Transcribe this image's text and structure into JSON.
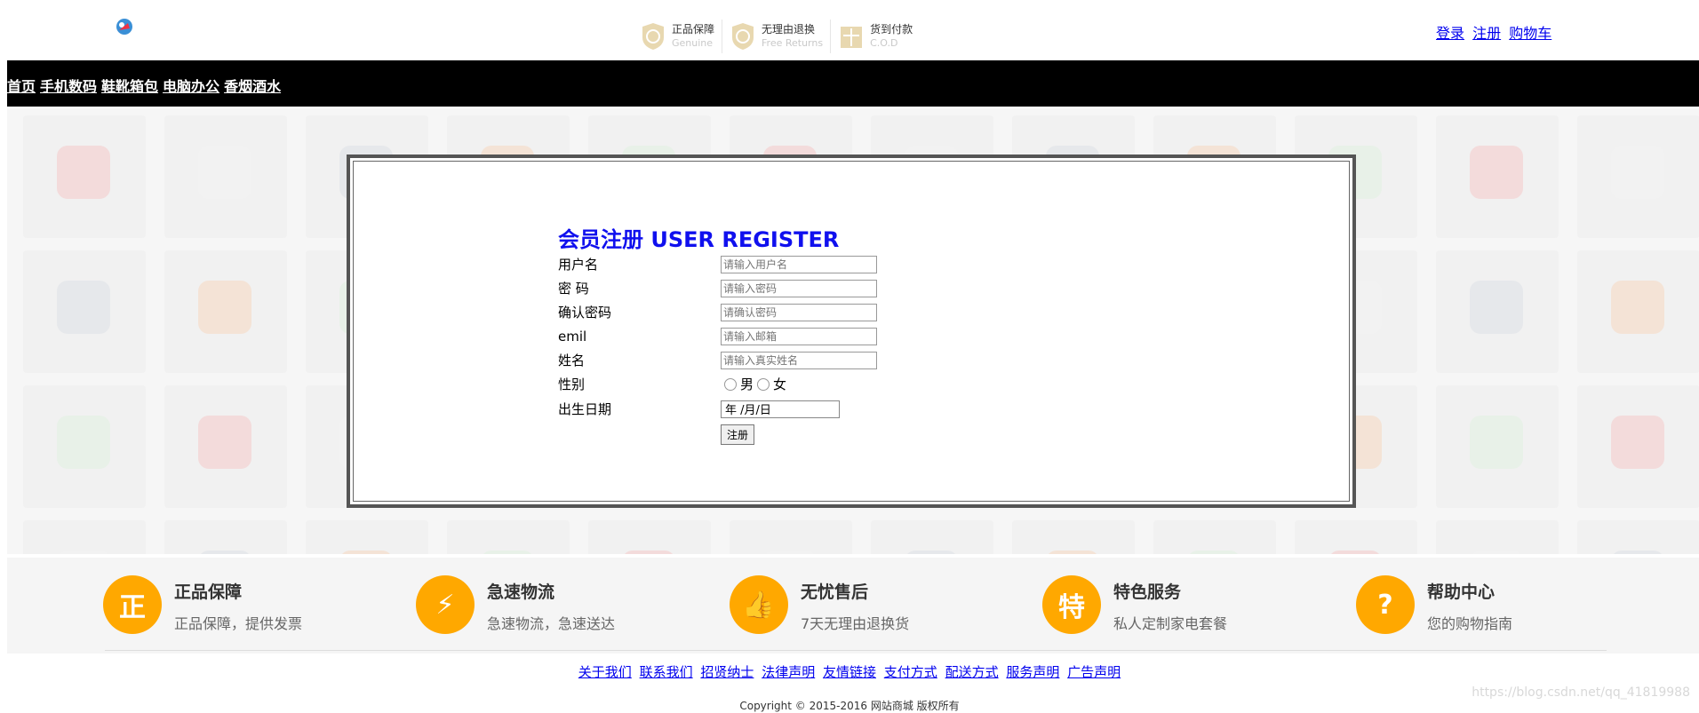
{
  "header": {
    "guarantees": [
      {
        "cn": "正品保障",
        "en": "Genuine",
        "icon": "genuine-shield-icon"
      },
      {
        "cn": "无理由退换",
        "en": "Free Returns",
        "icon": "returns-shield-icon"
      },
      {
        "cn": "货到付款",
        "en": "C.O.D",
        "icon": "cod-icon"
      }
    ],
    "links": {
      "login": "登录",
      "register": "注册",
      "cart": "购物车"
    }
  },
  "nav": {
    "items": [
      "首页",
      "手机数码",
      "鞋靴箱包",
      "电脑办公",
      "香烟酒水"
    ]
  },
  "form": {
    "title": "会员注册 USER REGISTER",
    "fields": {
      "username": {
        "label": "用户名",
        "placeholder": "请输入用户名"
      },
      "password": {
        "label": "密 码",
        "placeholder": "请输入密码"
      },
      "confirm": {
        "label": "确认密码",
        "placeholder": "请确认密码"
      },
      "email": {
        "label": "emil",
        "placeholder": "请输入邮箱"
      },
      "realname": {
        "label": "姓名",
        "placeholder": "请输入真实姓名"
      }
    },
    "gender": {
      "label": "性别",
      "male": "男",
      "female": "女"
    },
    "birth": {
      "label": "出生日期",
      "placeholder": "年 /月/日"
    },
    "submit": "注册"
  },
  "features": [
    {
      "title": "正品保障",
      "desc": "正品保障，提供发票",
      "icon": "genuine-icon",
      "glyph": "正"
    },
    {
      "title": "急速物流",
      "desc": "急速物流，急速送达",
      "icon": "logistics-icon",
      "glyph": "⚡"
    },
    {
      "title": "无忧售后",
      "desc": "7天无理由退换货",
      "icon": "thumbs-up-icon",
      "glyph": "👍"
    },
    {
      "title": "特色服务",
      "desc": "私人定制家电套餐",
      "icon": "special-service-icon",
      "glyph": "特"
    },
    {
      "title": "帮助中心",
      "desc": "您的购物指南",
      "icon": "help-icon",
      "glyph": "?"
    }
  ],
  "footer": {
    "links": [
      "关于我们",
      "联系我们",
      "招贤纳士",
      "法律声明",
      "友情链接",
      "支付方式",
      "配送方式",
      "服务声明",
      "广告声明"
    ],
    "copyright": "Copyright © 2015-2016 网站商城 版权所有",
    "watermark": "https://blog.csdn.net/qq_41819988"
  },
  "colors": {
    "accent": "#ffa800",
    "title": "#1010ee",
    "nav_bg": "#000000"
  }
}
